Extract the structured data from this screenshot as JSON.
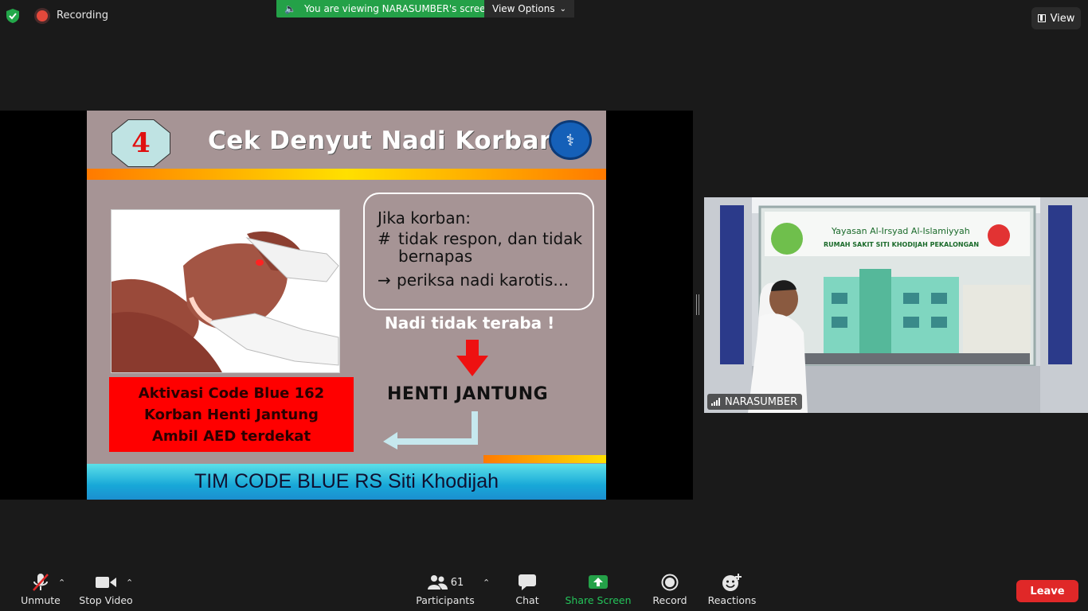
{
  "topbar": {
    "recording_label": "Recording",
    "viewing_banner": "You are viewing NARASUMBER's screen",
    "view_options_label": "View Options",
    "view_button_label": "View"
  },
  "slide": {
    "step_number": "4",
    "title": "Cek  Denyut Nadi Korban",
    "info_line1": "Jika korban:",
    "info_marker_hash": "#",
    "info_line2": "tidak respon,  dan tidak",
    "info_line3": "bernapas",
    "info_marker_arrow": "→",
    "info_line4": "periksa nadi karotis…",
    "pulse_text": "Nadi tidak teraba !",
    "arrest_text": "HENTI JANTUNG",
    "action_line1": "Aktivasi Code Blue 162",
    "action_line2": "Korban Henti Jantung",
    "action_line3": "Ambil AED terdekat",
    "footer": "TIM CODE BLUE RS Siti Khodijah"
  },
  "video": {
    "participant_name": "NARASUMBER"
  },
  "toolbar": {
    "unmute_label": "Unmute",
    "stop_video_label": "Stop Video",
    "participants_count": "61",
    "participants_label": "Participants",
    "chat_label": "Chat",
    "share_screen_label": "Share Screen",
    "record_label": "Record",
    "reactions_label": "Reactions",
    "leave_label": "Leave"
  },
  "colors": {
    "share_green": "#24a148",
    "leave_red": "#e02828",
    "recording_red": "#e5483b"
  }
}
